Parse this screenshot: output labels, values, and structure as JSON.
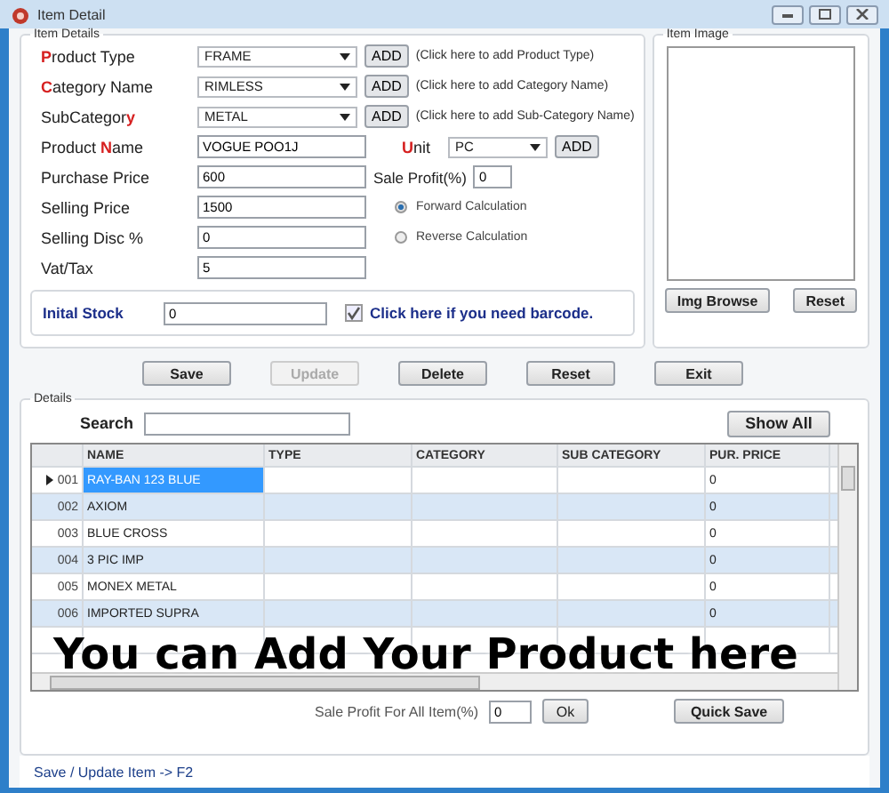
{
  "window": {
    "title": "Item Detail"
  },
  "item_details": {
    "legend": "Item Details",
    "rows": [
      {
        "label": [
          {
            "text": "P",
            "accent": true
          },
          {
            "text": "roduct Type",
            "accent": false
          }
        ],
        "field": {
          "kind": "select",
          "value": "FRAME"
        },
        "add": "ADD",
        "hint": "(Click here to add Product Type)"
      },
      {
        "label": [
          {
            "text": "C",
            "accent": true
          },
          {
            "text": "ategory Name",
            "accent": false
          }
        ],
        "field": {
          "kind": "select",
          "value": "RIMLESS"
        },
        "add": "ADD",
        "hint": "(Click here to add Category Name)"
      },
      {
        "label": [
          {
            "text": "SubCategor",
            "accent": false
          },
          {
            "text": "y",
            "accent": true
          }
        ],
        "field": {
          "kind": "select",
          "value": "METAL"
        },
        "add": "ADD",
        "hint": "(Click here to add Sub-Category Name)"
      },
      {
        "label": [
          {
            "text": "Product ",
            "accent": false
          },
          {
            "text": "N",
            "accent": true
          },
          {
            "text": "ame",
            "accent": false
          }
        ],
        "field": {
          "kind": "text",
          "value": "VOGUE POO1J"
        },
        "extra": {
          "kind": "unit",
          "label": [
            {
              "text": "U",
              "accent": true
            },
            {
              "text": "nit",
              "accent": false
            }
          ],
          "value": "PC",
          "add": "ADD"
        }
      },
      {
        "label": [
          {
            "text": "Purchase Price",
            "accent": false
          }
        ],
        "field": {
          "kind": "text",
          "value": "600"
        },
        "extra": {
          "kind": "profit",
          "label": "Sale Profit(%)",
          "value": "0"
        }
      },
      {
        "label": [
          {
            "text": "Selling Price",
            "accent": false
          }
        ],
        "field": {
          "kind": "text",
          "value": "1500"
        },
        "extra": {
          "kind": "radio",
          "label": "Forward Calculation",
          "selected": true
        }
      },
      {
        "label": [
          {
            "text": "Selling Disc %",
            "accent": false
          }
        ],
        "field": {
          "kind": "text",
          "value": "0"
        },
        "extra": {
          "kind": "radio",
          "label": "Reverse Calculation",
          "selected": false
        }
      },
      {
        "label": [
          {
            "text": "Vat/Tax",
            "accent": false
          }
        ],
        "field": {
          "kind": "text",
          "value": "5"
        }
      }
    ],
    "stock": {
      "label": "Inital Stock",
      "value": "0",
      "barcode_label": "Click here if you need barcode.",
      "barcode_checked": true
    }
  },
  "item_image": {
    "legend": "Item Image",
    "buttons": [
      "Img Browse",
      "Reset"
    ]
  },
  "actions": [
    {
      "label": "Save",
      "disabled": false
    },
    {
      "label": "Update",
      "disabled": true
    },
    {
      "label": "Delete",
      "disabled": false
    },
    {
      "label": "Reset",
      "disabled": false
    },
    {
      "label": "Exit",
      "disabled": false
    }
  ],
  "details": {
    "legend": "Details",
    "search_label": "Search",
    "show_all": "Show All",
    "table": {
      "columns": [
        "NAME",
        "TYPE",
        "CATEGORY",
        "SUB CATEGORY",
        "PUR. PRICE"
      ],
      "rows": [
        {
          "no": "001",
          "name": "RAY-BAN 123 BLUE",
          "price": "0",
          "selected": true
        },
        {
          "no": "002",
          "name": "AXIOM",
          "price": "0",
          "selected": false
        },
        {
          "no": "003",
          "name": "BLUE CROSS",
          "price": "0",
          "selected": false
        },
        {
          "no": "004",
          "name": "3 PIC IMP",
          "price": "0",
          "selected": false
        },
        {
          "no": "005",
          "name": "MONEX METAL",
          "price": "0",
          "selected": false
        },
        {
          "no": "006",
          "name": "IMPORTED SUPRA",
          "price": "0",
          "selected": false
        }
      ]
    },
    "profit_label": "Sale Profit For All Item(%)",
    "profit_value": "0",
    "ok": "Ok",
    "quick_save": "Quick Save"
  },
  "status": "Save / Update Item -> F2",
  "caption": "You can Add Your Product here"
}
